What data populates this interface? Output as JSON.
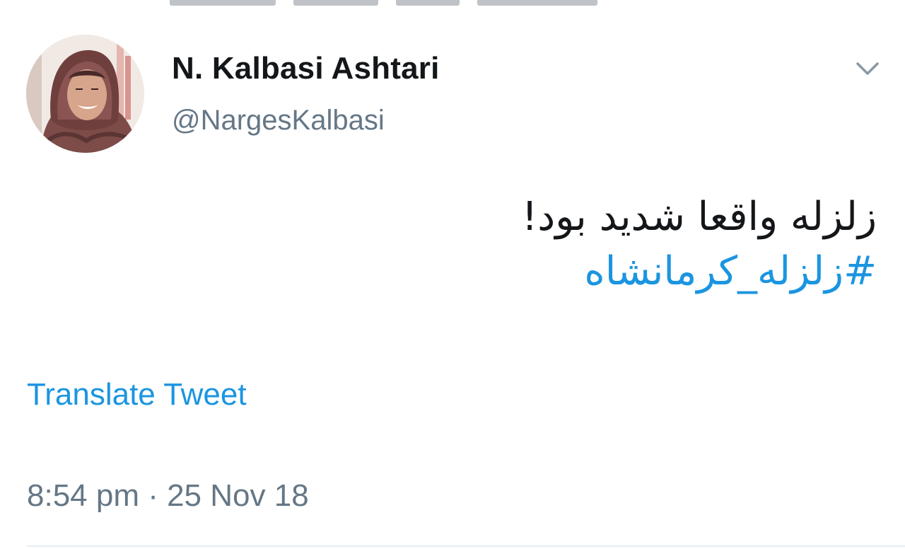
{
  "tweet": {
    "display_name": "N. Kalbasi Ashtari",
    "handle": "@NargesKalbasi",
    "text": "زلزله واقعا شدید بود!",
    "hashtag": "#زلزله_کرمانشاه",
    "translate_label": "Translate Tweet",
    "timestamp": "8:54 pm · 25 Nov 18"
  },
  "icons": {
    "more_menu": "chevron-down-icon"
  },
  "colors": {
    "text_primary": "#14171a",
    "text_secondary": "#657786",
    "link": "#1b95e0",
    "divider": "#e6ecf0"
  }
}
